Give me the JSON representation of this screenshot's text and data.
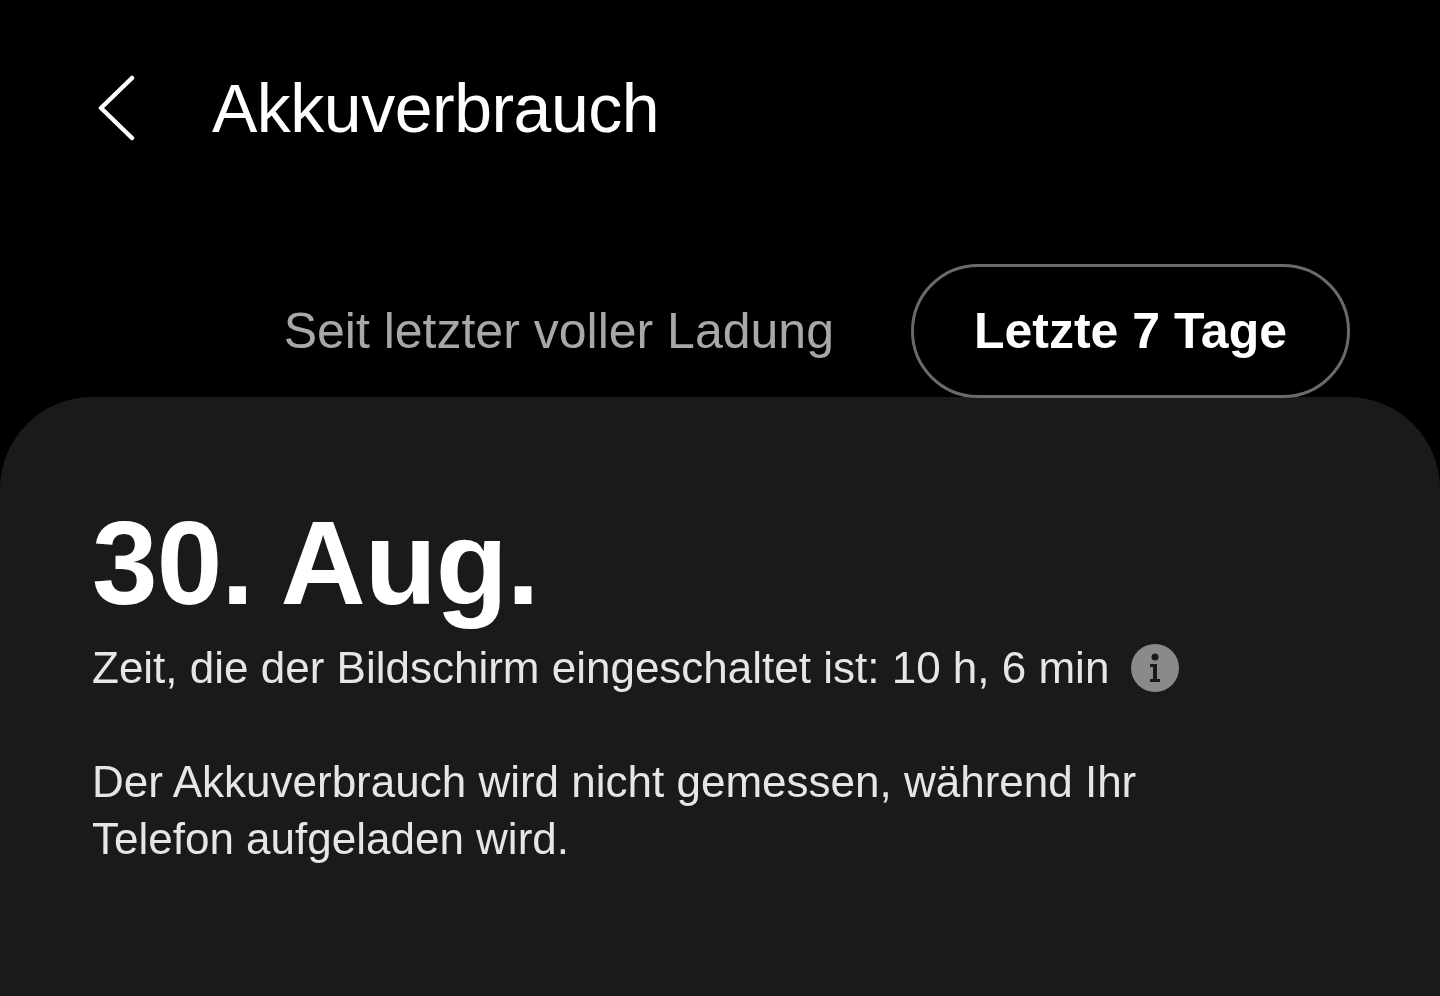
{
  "header": {
    "title": "Akkuverbrauch"
  },
  "tabs": [
    {
      "label": "Seit letzter voller Ladung",
      "selected": false
    },
    {
      "label": "Letzte 7 Tage",
      "selected": true
    }
  ],
  "card": {
    "date": "30. Aug.",
    "screen_time": "Zeit, die der Bildschirm eingeschaltet ist: 10 h, 6 min",
    "note": "Der Akkuverbrauch wird nicht gemessen, während Ihr Telefon aufgeladen wird."
  }
}
